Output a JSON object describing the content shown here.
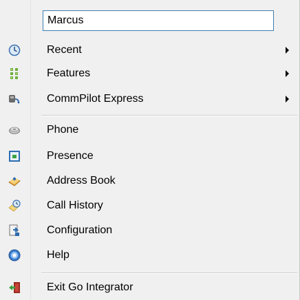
{
  "menu": {
    "search_value": "Marcus",
    "items": [
      {
        "label": "Recent",
        "icon": "clock-icon",
        "submenu": true
      },
      {
        "label": "Features",
        "icon": "features-grid-icon",
        "submenu": true
      },
      {
        "label": "CommPilot Express",
        "icon": "commpilot-icon",
        "submenu": true
      },
      {
        "label": "Phone",
        "icon": "phone-icon",
        "submenu": false
      },
      {
        "label": "Presence",
        "icon": "presence-icon",
        "submenu": false
      },
      {
        "label": "Address Book",
        "icon": "address-book-icon",
        "submenu": false
      },
      {
        "label": "Call History",
        "icon": "call-history-icon",
        "submenu": false
      },
      {
        "label": "Configuration",
        "icon": "configuration-icon",
        "submenu": false
      },
      {
        "label": "Help",
        "icon": "help-icon",
        "submenu": false
      },
      {
        "label": "Exit Go Integrator",
        "icon": "exit-icon",
        "submenu": false
      }
    ]
  },
  "colors": {
    "menu_background": "#f0f0f0",
    "input_border": "#3c7fb1",
    "separator": "#cfcfcf"
  }
}
